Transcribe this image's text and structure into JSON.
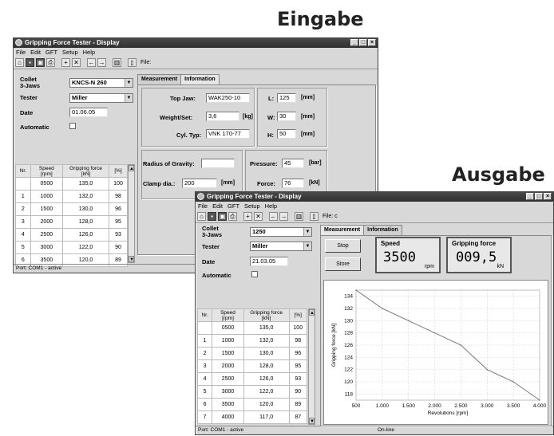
{
  "labels": {
    "input": "Eingabe",
    "output": "Ausgabe"
  },
  "colors": {
    "titlebar": "#3a3a3a",
    "chart_line": "#777777"
  },
  "window1": {
    "title": "Gripping Force Tester - Display",
    "menu": [
      "File",
      "Edit",
      "GFT",
      "Setup",
      "Help"
    ],
    "toolbar": {
      "file_label": "File:"
    },
    "collet": {
      "label": "Collet\n3-Jaws",
      "value": "KNCS-N 260"
    },
    "tester": {
      "label": "Tester",
      "value": "Miller"
    },
    "date": {
      "label": "Date",
      "value": "01.06.05"
    },
    "automatic": {
      "label": "Automatic"
    },
    "tabs": [
      "Measurement",
      "Information"
    ],
    "top_jaw": {
      "label": "Top Jaw:",
      "value": "WAK250-10"
    },
    "weight_set": {
      "label": "Weight/Set:",
      "value": "3,6",
      "unit": "[kg]"
    },
    "cyl_typ": {
      "label": "Cyl. Typ:",
      "value": "VNK 170-77"
    },
    "L": {
      "label": "L:",
      "value": "125",
      "unit": "[mm]"
    },
    "W": {
      "label": "W:",
      "value": "30",
      "unit": "[mm]"
    },
    "H": {
      "label": "H:",
      "value": "50",
      "unit": "[mm]"
    },
    "radius": {
      "label": "Radius of Gravity:",
      "value": ""
    },
    "clamp": {
      "label": "Clamp dia.:",
      "value": "200",
      "unit": "[mm]"
    },
    "pressure": {
      "label": "Pressure:",
      "value": "45",
      "unit": "[bar]"
    },
    "force": {
      "label": "Force:",
      "value": "76",
      "unit": "[kN]"
    },
    "table": {
      "headers": [
        "Nr.",
        "Speed\n[rpm]",
        "Gripping force\n[kN]",
        "[%]"
      ],
      "rows": [
        [
          "",
          "0500",
          "135,0",
          "100"
        ],
        [
          "1",
          "1000",
          "132,0",
          "98"
        ],
        [
          "2",
          "1500",
          "130,0",
          "96"
        ],
        [
          "3",
          "2000",
          "128,0",
          "95"
        ],
        [
          "4",
          "2500",
          "126,0",
          "93"
        ],
        [
          "5",
          "3000",
          "122,0",
          "90"
        ],
        [
          "6",
          "3500",
          "120,0",
          "89"
        ]
      ]
    },
    "status": "Port: COM1 - active"
  },
  "window2": {
    "title": "Gripping Force Tester - Display",
    "menu": [
      "File",
      "Edit",
      "GFT",
      "Setup",
      "Help"
    ],
    "toolbar": {
      "file_label": "File: c"
    },
    "collet": {
      "label": "Collet\n3-Jaws",
      "value": "1250"
    },
    "tester": {
      "label": "Tester",
      "value": "Miller"
    },
    "date": {
      "label": "Date",
      "value": "21.03.05"
    },
    "automatic": {
      "label": "Automatic"
    },
    "tabs": [
      "Measurement",
      "Information"
    ],
    "stop_label": "Stop",
    "store_label": "Store",
    "speed": {
      "label": "Speed",
      "value": "3500",
      "unit": "rpm"
    },
    "gripping": {
      "label": "Gripping force",
      "value": "009,5",
      "unit": "kN"
    },
    "table": {
      "headers": [
        "Nr.",
        "Speed\n[rpm]",
        "Gripping force\n[kN]",
        "[%]"
      ],
      "rows": [
        [
          "",
          "0500",
          "135,0",
          "100"
        ],
        [
          "1",
          "1000",
          "132,0",
          "98"
        ],
        [
          "2",
          "1500",
          "130,0",
          "96"
        ],
        [
          "3",
          "2000",
          "128,0",
          "95"
        ],
        [
          "4",
          "2500",
          "126,0",
          "93"
        ],
        [
          "5",
          "3000",
          "122,0",
          "90"
        ],
        [
          "6",
          "3500",
          "120,0",
          "89"
        ],
        [
          "7",
          "4000",
          "117,0",
          "87"
        ]
      ]
    },
    "status_left": "Port: COM1 - active",
    "status_right": "On-line"
  },
  "chart_data": {
    "type": "line",
    "x": [
      500,
      1000,
      1500,
      2000,
      2500,
      3000,
      3500,
      4000
    ],
    "x_ticks": [
      "500",
      "1.000",
      "1.500",
      "2.000",
      "2.500",
      "3.000",
      "3.500",
      "4.000"
    ],
    "y": [
      135,
      132,
      130,
      128,
      126,
      122,
      120,
      117
    ],
    "y_ticks": [
      118,
      120,
      122,
      124,
      126,
      128,
      130,
      132,
      134
    ],
    "xlabel": "Revolutions [rpm]",
    "ylabel": "Gripping force [kN]",
    "xlim": [
      500,
      4000
    ],
    "ylim": [
      117,
      135
    ],
    "grid": true
  }
}
